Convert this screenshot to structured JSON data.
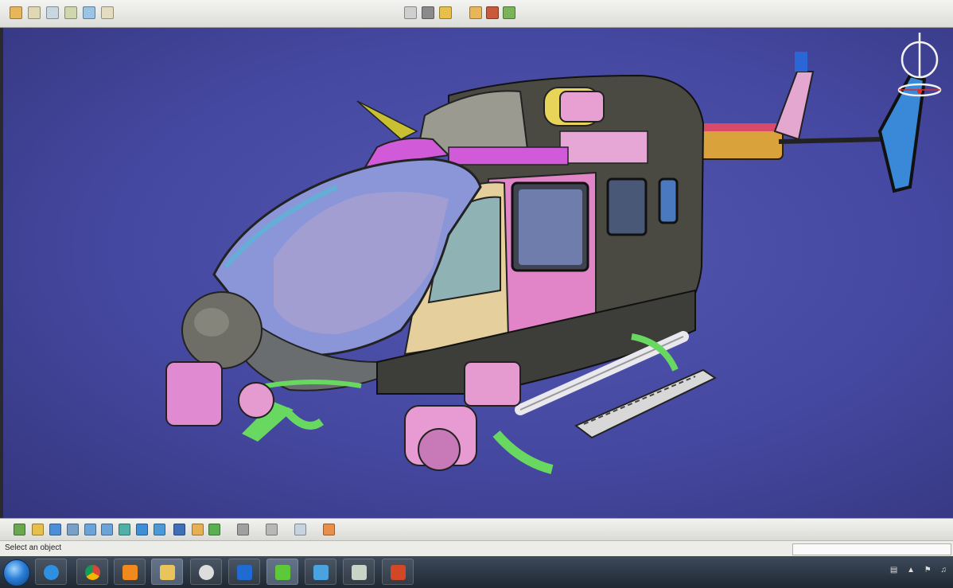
{
  "top_toolbar": {
    "groups": [
      {
        "name": "file-tools",
        "buttons": [
          "file-icon",
          "open-icon",
          "image-icon",
          "print-icon",
          "document-icon",
          "tool-icon"
        ]
      },
      {
        "name": "view-tools",
        "buttons": [
          "compass-icon",
          "lock-icon",
          "bulb-icon"
        ]
      },
      {
        "name": "render-tools",
        "buttons": [
          "globe-icon",
          "material-icon",
          "shading-icon"
        ]
      }
    ]
  },
  "viewport": {
    "compass_widget": "compass-icon"
  },
  "bottom_toolbar": {
    "buttons": [
      "fly-mode-icon",
      "fit-all-icon",
      "pan-icon",
      "rotate-icon",
      "zoom-in-icon",
      "zoom-out-icon",
      "normal-view-icon",
      "quick-view-icon",
      "iso-view-icon",
      "multi-view-icon",
      "shading-icon",
      "edges-icon",
      "hide-show-icon",
      "swap-space-icon",
      "render-icon",
      "catalog-icon",
      "grid-icon"
    ]
  },
  "status_bar": {
    "message": "Select an object"
  },
  "taskbar": {
    "start": "windows-start-icon",
    "apps": [
      {
        "name": "internet-explorer-icon",
        "color": "#2f8fe0"
      },
      {
        "name": "chrome-icon",
        "color": "#e8b32c"
      },
      {
        "name": "media-player-icon",
        "color": "#f08a1e"
      },
      {
        "name": "file-explorer-icon",
        "color": "#e9c45b"
      },
      {
        "name": "brain-app-icon",
        "color": "#dddddd"
      },
      {
        "name": "outlook-icon",
        "color": "#1f6bd1"
      },
      {
        "name": "catia-icon",
        "color": "#5cc83a"
      },
      {
        "name": "toolbar-app-icon",
        "color": "#4aa3df"
      },
      {
        "name": "window-app-icon",
        "color": "#c9d4c9"
      },
      {
        "name": "powerpoint-icon",
        "color": "#d24726"
      }
    ],
    "tray_icons": [
      "network-icon",
      "arrow-up-icon",
      "flag-icon",
      "volume-icon"
    ]
  }
}
